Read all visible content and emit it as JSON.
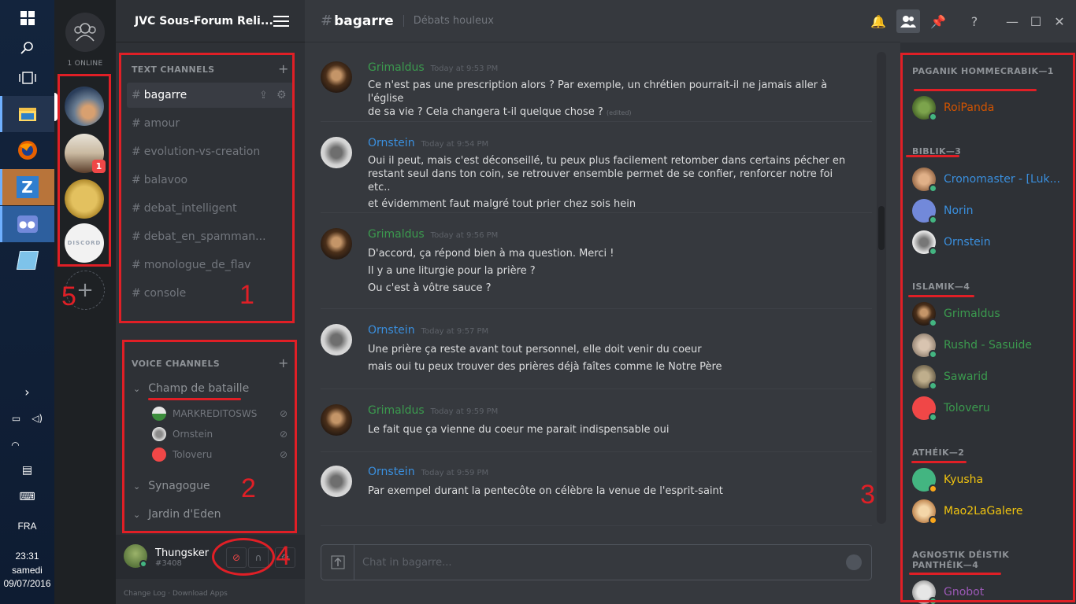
{
  "taskbar": {
    "language": "FRA",
    "time": "23:31",
    "day": "samedi",
    "date": "09/07/2016"
  },
  "servers": {
    "online_text": "1 ONLINE",
    "badge": "1",
    "add_label": "+"
  },
  "guild": {
    "name": "JVC Sous-Forum Reli...",
    "text_category": "TEXT CHANNELS",
    "voice_category": "VOICE CHANNELS",
    "text_channels": [
      "bagarre",
      "amour",
      "evolution-vs-creation",
      "balavoo",
      "debat_intelligent",
      "debat_en_spamman...",
      "monologue_de_flav",
      "console"
    ],
    "voice_channels": [
      "Champ de bataille",
      "Synagogue",
      "Jardin d'Eden"
    ],
    "voice_users": [
      "MARKREDITOSWS",
      "Ornstein",
      "Toloveru"
    ],
    "user": {
      "name": "Thungsker",
      "tag": "#3408"
    },
    "footer": "Change Log  ·  Download Apps"
  },
  "chat": {
    "hash": "#",
    "channel": "bagarre",
    "topic": "Débats houleux",
    "input_placeholder": "Chat in bagarre...",
    "messages": [
      {
        "author": "Grimaldus",
        "time": "Today at 9:53 PM",
        "lines": [
          "Ce n'est pas une prescription alors ? Par exemple, un chrétien pourrait-il ne jamais aller à l'église",
          "de sa vie ? Cela changera t-il quelque chose ?"
        ],
        "edited": "(edited)"
      },
      {
        "author": "Ornstein",
        "time": "Today at 9:54 PM",
        "lines": [
          "Oui il peut, mais c'est déconseillé, tu peux plus facilement retomber dans certains pécher en",
          "restant seul dans ton coin, se retrouver ensemble permet de se confier, renforcer notre foi etc..",
          "et évidemment faut malgré tout prier chez sois hein"
        ]
      },
      {
        "author": "Grimaldus",
        "time": "Today at 9:56 PM",
        "lines": [
          "D'accord, ça répond bien à ma question. Merci !",
          "Il y a une liturgie pour la prière ?",
          "Ou c'est à vôtre sauce ?"
        ]
      },
      {
        "author": "Ornstein",
        "time": "Today at 9:57 PM",
        "lines": [
          "Une prière ça reste avant tout personnel, elle doit venir du coeur",
          "mais oui tu peux trouver des prières déjà faîtes comme le Notre Père"
        ]
      },
      {
        "author": "Grimaldus",
        "time": "Today at 9:59 PM",
        "lines": [
          "Le fait que ça vienne du coeur me parait indispensable oui"
        ]
      },
      {
        "author": "Ornstein",
        "time": "Today at 9:59 PM",
        "lines": [
          "Par exempel durant la pentecôte on célèbre la venue de l'esprit-saint"
        ]
      }
    ]
  },
  "members": {
    "groups": [
      {
        "title": "PAGANIK HOMMECRABIK—1",
        "members": [
          {
            "name": "RoiPanda",
            "color": "#d35400"
          }
        ]
      },
      {
        "title": "BIBLIK—3",
        "members": [
          {
            "name": "Cronomaster - [Luk...",
            "color": "#3a8fde"
          },
          {
            "name": "Norin",
            "color": "#3a8fde"
          },
          {
            "name": "Ornstein",
            "color": "#3a8fde"
          }
        ]
      },
      {
        "title": "ISLAMIK—4",
        "members": [
          {
            "name": "Grimaldus",
            "color": "#3b9a4e"
          },
          {
            "name": "Rushd - Sasuide",
            "color": "#3b9a4e"
          },
          {
            "name": "Sawarid",
            "color": "#3b9a4e"
          },
          {
            "name": "Toloveru",
            "color": "#3b9a4e"
          }
        ]
      },
      {
        "title": "ATHÉIK—2",
        "members": [
          {
            "name": "Kyusha",
            "color": "#f1c40f"
          },
          {
            "name": "Mao2LaGalere",
            "color": "#f1c40f"
          }
        ]
      },
      {
        "title": "AGNOSTIK DÉISTIK PANTHÉIK—4",
        "members": [
          {
            "name": "Gnobot",
            "color": "#9b59b6"
          }
        ]
      }
    ]
  },
  "annotations": [
    "1",
    "2",
    "3",
    "4",
    "5"
  ],
  "colors": {
    "annotation": "#e01f26",
    "grimaldus": "#3b9a4e",
    "ornstein": "#3a8fde"
  }
}
